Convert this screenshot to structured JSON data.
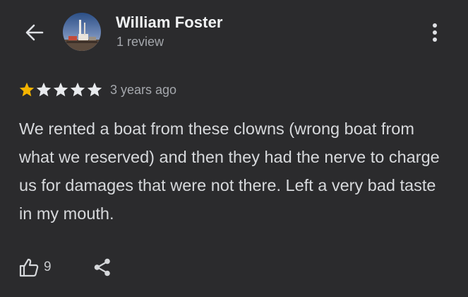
{
  "header": {
    "reviewer_name": "William Foster",
    "review_count": "1 review",
    "icons": {
      "back": "arrow-back-icon",
      "more": "more-vert-icon"
    }
  },
  "review": {
    "rating": 1,
    "max_rating": 5,
    "age": "3 years ago",
    "text": "We rented a boat from these clowns (wrong boat from what we reserved) and then they had the nerve to charge us for damages that were not there. Left a very bad taste in my mouth."
  },
  "actions": {
    "like_count": "9",
    "icons": {
      "like": "thumb-up-icon",
      "share": "share-icon"
    }
  },
  "colors": {
    "background": "#2b2b2d",
    "star_filled": "#f4b400",
    "star_empty": "#e8eaed",
    "primary_text": "#f1f3f4",
    "secondary_text": "#a5a8ad"
  }
}
